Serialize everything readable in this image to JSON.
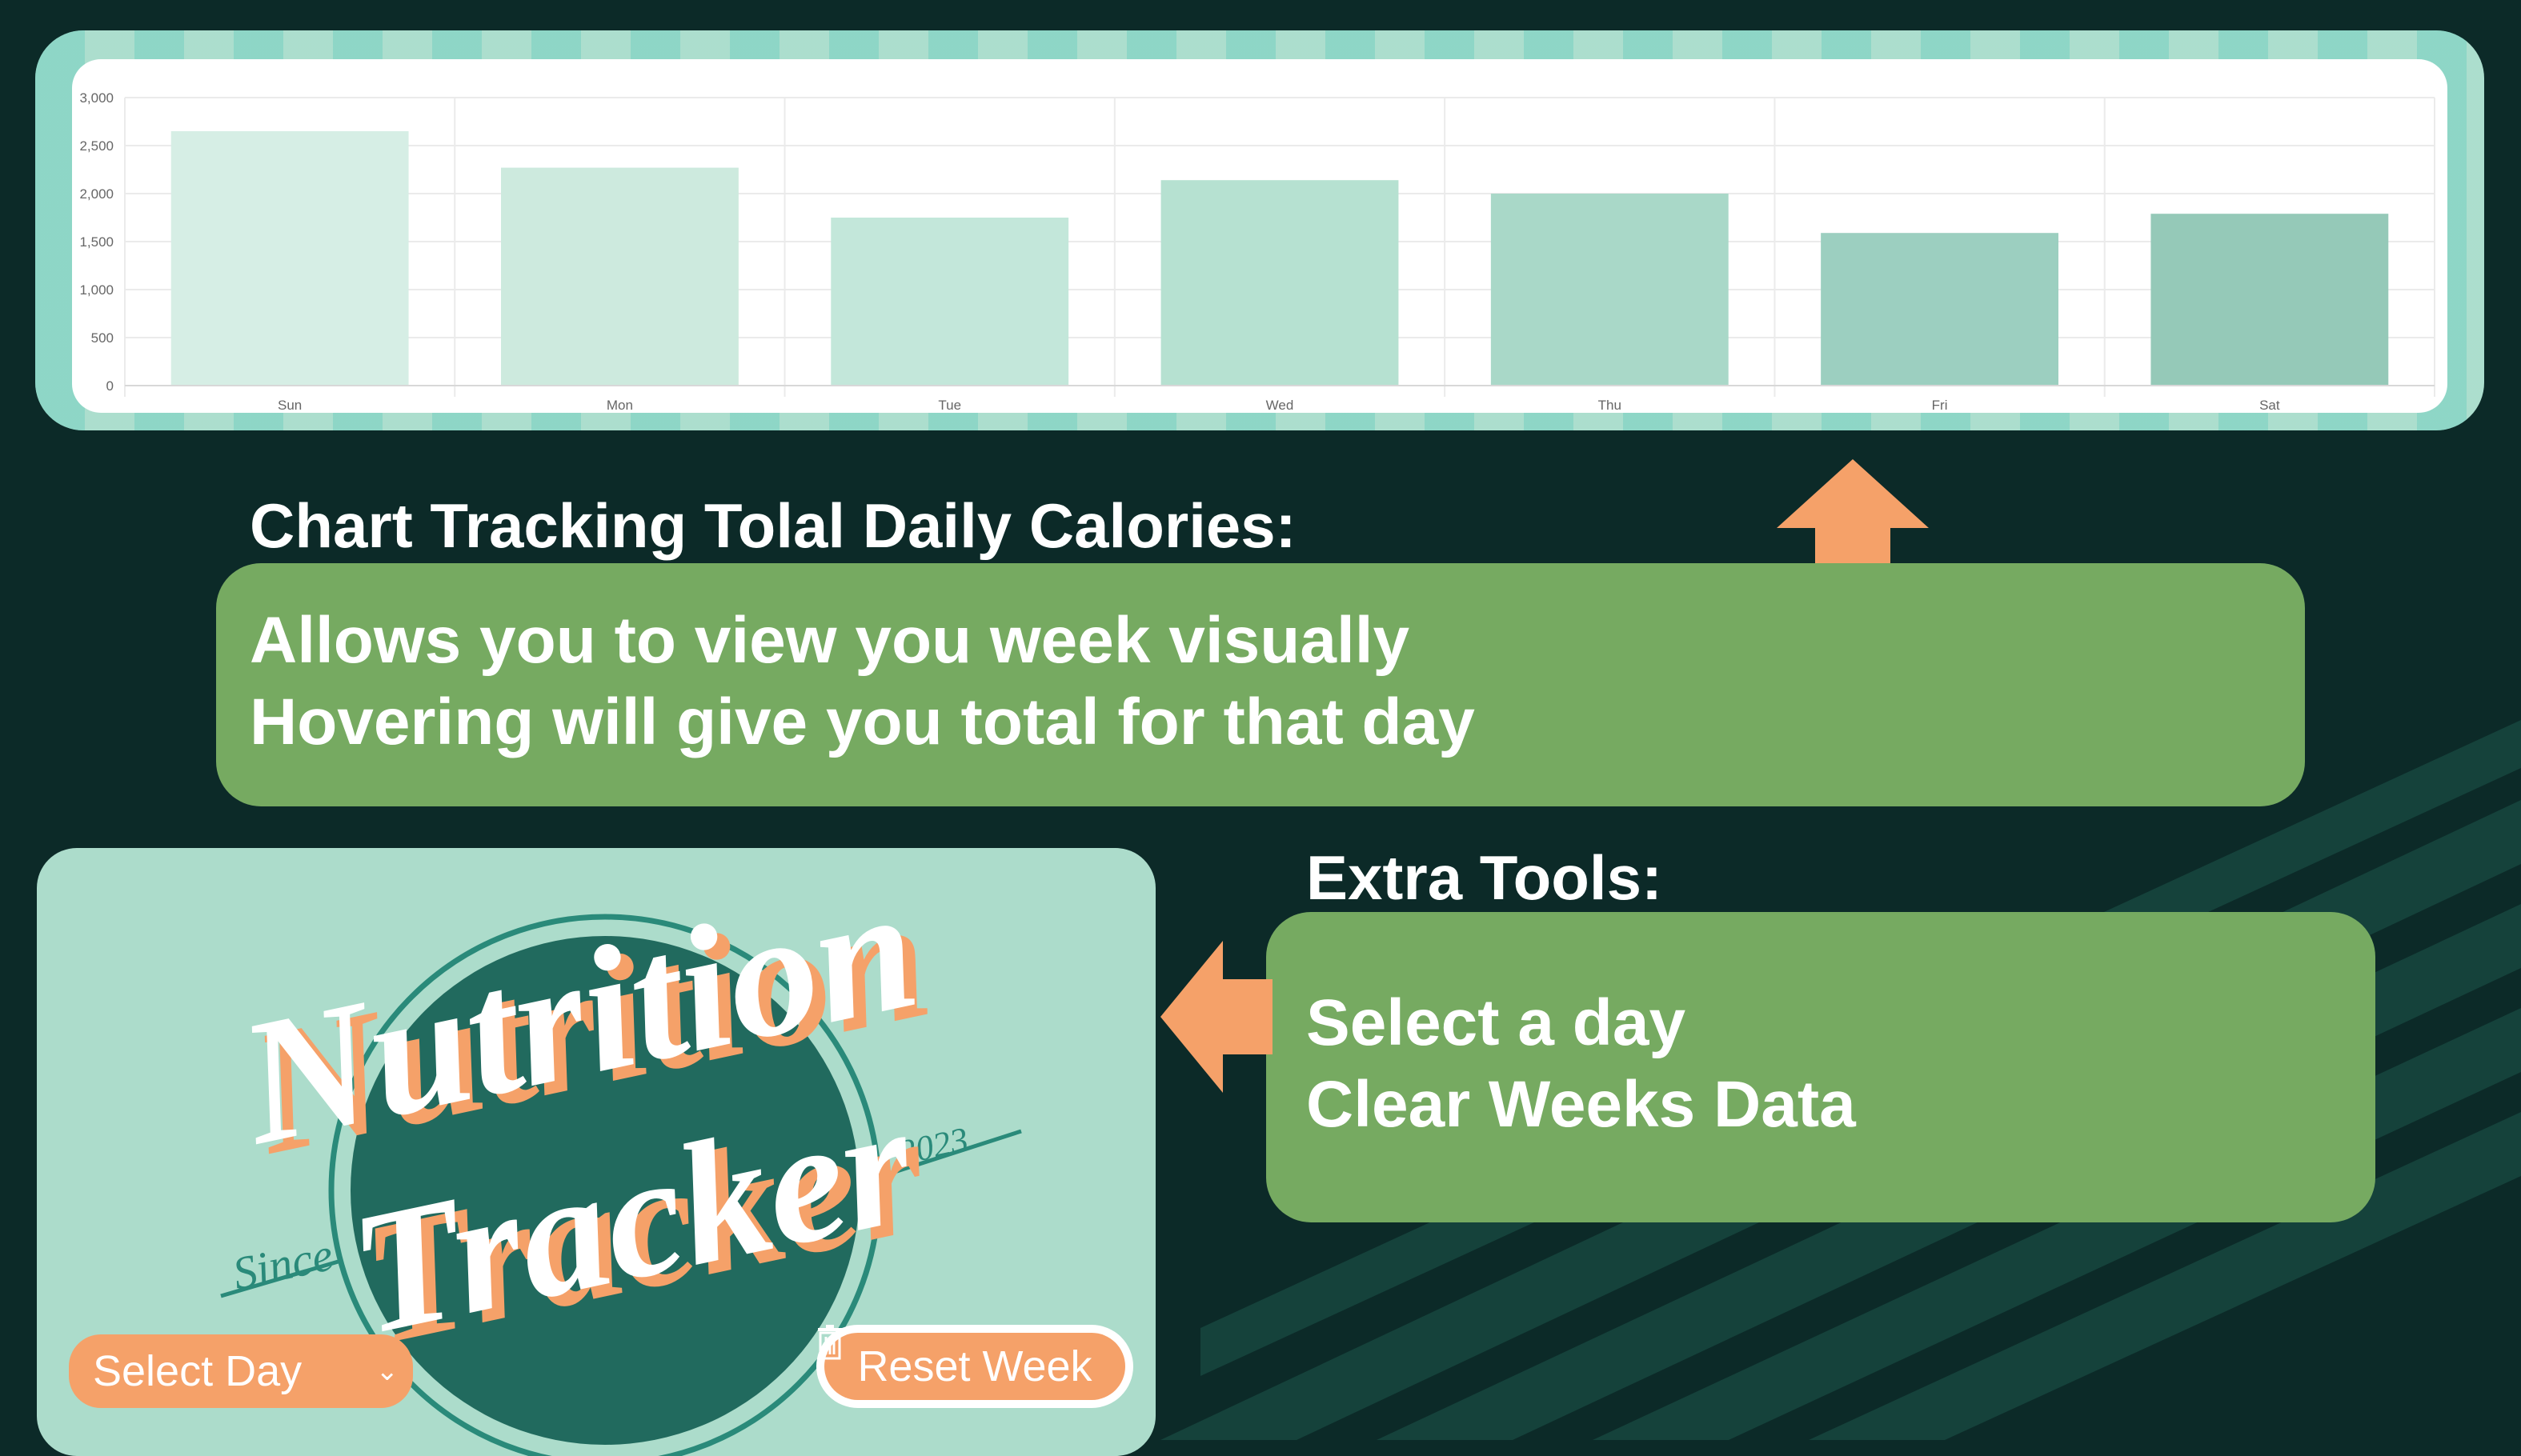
{
  "colors": {
    "background": "#0c2a28",
    "callout_green": "#76aa61",
    "accent_orange": "#f5a169",
    "panel_mint": "#acdccb",
    "logo_teal": "#216a5e",
    "bar_colors": [
      "#d6eee5",
      "#cdeade",
      "#c3e7da",
      "#b6e1d1",
      "#a9d8c8",
      "#9ccfc0",
      "#95c9b8"
    ]
  },
  "chart_data": {
    "type": "bar",
    "categories": [
      "Sun",
      "Mon",
      "Tue",
      "Wed",
      "Thu",
      "Fri",
      "Sat"
    ],
    "values": [
      2650,
      2270,
      1750,
      2140,
      2000,
      1590,
      1790
    ],
    "ylim": [
      0,
      3000
    ],
    "yticks": [
      0,
      500,
      1000,
      1500,
      2000,
      2500,
      3000
    ],
    "ytick_labels": [
      "0",
      "500",
      "1,000",
      "1,500",
      "2,000",
      "2,500",
      "3,000"
    ],
    "grid": true,
    "legend": "none"
  },
  "chart_heading": "Chart Tracking Tolal Daily Calories:",
  "chart_callout": {
    "lines": [
      "Allows you to view you week visually",
      "Hovering will give you total for that day"
    ]
  },
  "tools_heading": "Extra Tools:",
  "tools_callout": {
    "lines": [
      "Select a day",
      "Clear Weeks Data"
    ]
  },
  "logo": {
    "word1": "Nutrition",
    "word2": "Tracker",
    "since": "Since",
    "year": "2023"
  },
  "controls": {
    "select_day_label": "Select Day",
    "select_icon": "chevron-down-icon",
    "reset_week_label": "Reset Week",
    "reset_icon": "trash-icon"
  }
}
